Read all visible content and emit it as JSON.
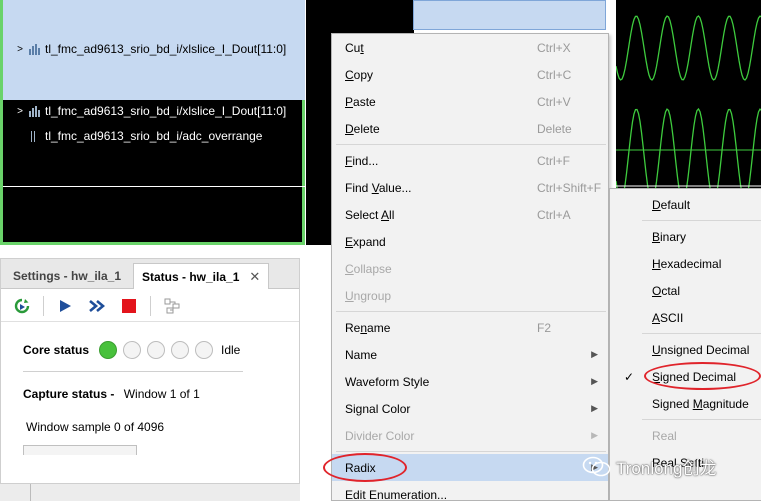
{
  "waveform": {
    "signals": [
      {
        "name": "tl_fmc_ad9613_srio_bd_i/xlslice_I_Dout[11:0]",
        "expandable": true
      },
      {
        "name": "tl_fmc_ad9613_srio_bd_i/xlslice_I_Dout[11:0]",
        "expandable": true
      },
      {
        "name": "tl_fmc_ad9613_srio_bd_i/adc_overrange",
        "expandable": false
      }
    ],
    "expand_glyph": ">",
    "trace_color": "#3ecb3e"
  },
  "panel": {
    "tabs": [
      {
        "label": "Settings - hw_ila_1",
        "active": false
      },
      {
        "label": "Status - hw_ila_1",
        "active": true
      }
    ],
    "close_glyph": "✕",
    "core_status_label": "Core status",
    "core_status_value": "Idle",
    "capture_status_label": "Capture status -",
    "capture_status_value": "Window 1 of 1",
    "window_sample": "Window sample 0 of 4096",
    "toolbar_icons": [
      "run-trigger-immediate-icon",
      "run-icon",
      "run-continuous-icon",
      "stop-icon",
      "layout-icon"
    ],
    "status_led_color": "#48c13c"
  },
  "context_menu": {
    "items": [
      {
        "label_pre": "Cu",
        "label_u": "t",
        "label_post": "",
        "shortcut": "Ctrl+X"
      },
      {
        "label_pre": "",
        "label_u": "C",
        "label_post": "opy",
        "shortcut": "Ctrl+C"
      },
      {
        "label_pre": "",
        "label_u": "P",
        "label_post": "aste",
        "shortcut": "Ctrl+V"
      },
      {
        "label_pre": "",
        "label_u": "D",
        "label_post": "elete",
        "shortcut": "Delete"
      },
      {
        "label_pre": "",
        "label_u": "F",
        "label_post": "ind...",
        "shortcut": "Ctrl+F"
      },
      {
        "label_pre": "Find ",
        "label_u": "V",
        "label_post": "alue...",
        "shortcut": "Ctrl+Shift+F"
      },
      {
        "label_pre": "Select ",
        "label_u": "A",
        "label_post": "ll",
        "shortcut": "Ctrl+A"
      },
      {
        "label_pre": "",
        "label_u": "E",
        "label_post": "xpand",
        "shortcut": ""
      },
      {
        "label_pre": "",
        "label_u": "C",
        "label_post": "ollapse",
        "shortcut": ""
      },
      {
        "label_pre": "",
        "label_u": "U",
        "label_post": "ngroup",
        "shortcut": ""
      },
      {
        "label_pre": "Re",
        "label_u": "n",
        "label_post": "ame",
        "shortcut": "F2"
      },
      {
        "label_pre": "Name",
        "label_u": "",
        "label_post": "",
        "shortcut": ""
      },
      {
        "label_pre": "Waveform Style",
        "label_u": "",
        "label_post": "",
        "shortcut": ""
      },
      {
        "label_pre": "Signal Color",
        "label_u": "",
        "label_post": "",
        "shortcut": ""
      },
      {
        "label_pre": "Divider Color",
        "label_u": "",
        "label_post": "",
        "shortcut": ""
      },
      {
        "label_pre": "Radix",
        "label_u": "",
        "label_post": "",
        "shortcut": ""
      },
      {
        "label_pre": "Edit Enumeration...",
        "label_u": "",
        "label_post": "",
        "shortcut": ""
      }
    ],
    "submenu_arrow": "▶",
    "highlighted_item": "Radix"
  },
  "radix_submenu": {
    "items": [
      {
        "label_pre": "",
        "label_u": "D",
        "label_post": "efault"
      },
      {
        "label_pre": "",
        "label_u": "B",
        "label_post": "inary"
      },
      {
        "label_pre": "",
        "label_u": "H",
        "label_post": "exadecimal"
      },
      {
        "label_pre": "",
        "label_u": "O",
        "label_post": "ctal"
      },
      {
        "label_pre": "",
        "label_u": "A",
        "label_post": "SCII"
      },
      {
        "label_pre": "",
        "label_u": "U",
        "label_post": "nsigned Decimal"
      },
      {
        "label_pre": "",
        "label_u": "S",
        "label_post": "igned Decimal"
      },
      {
        "label_pre": "Signed ",
        "label_u": "M",
        "label_post": "agnitude"
      },
      {
        "label_pre": "Real",
        "label_u": "",
        "label_post": ""
      },
      {
        "label_pre": "Real Setti",
        "label_u": "",
        "label_post": ""
      }
    ],
    "checked_item": "Signed Decimal",
    "check_glyph": "✓"
  },
  "watermark": {
    "text": "Tronlong创龙"
  },
  "highlight_color": "#e0242b"
}
